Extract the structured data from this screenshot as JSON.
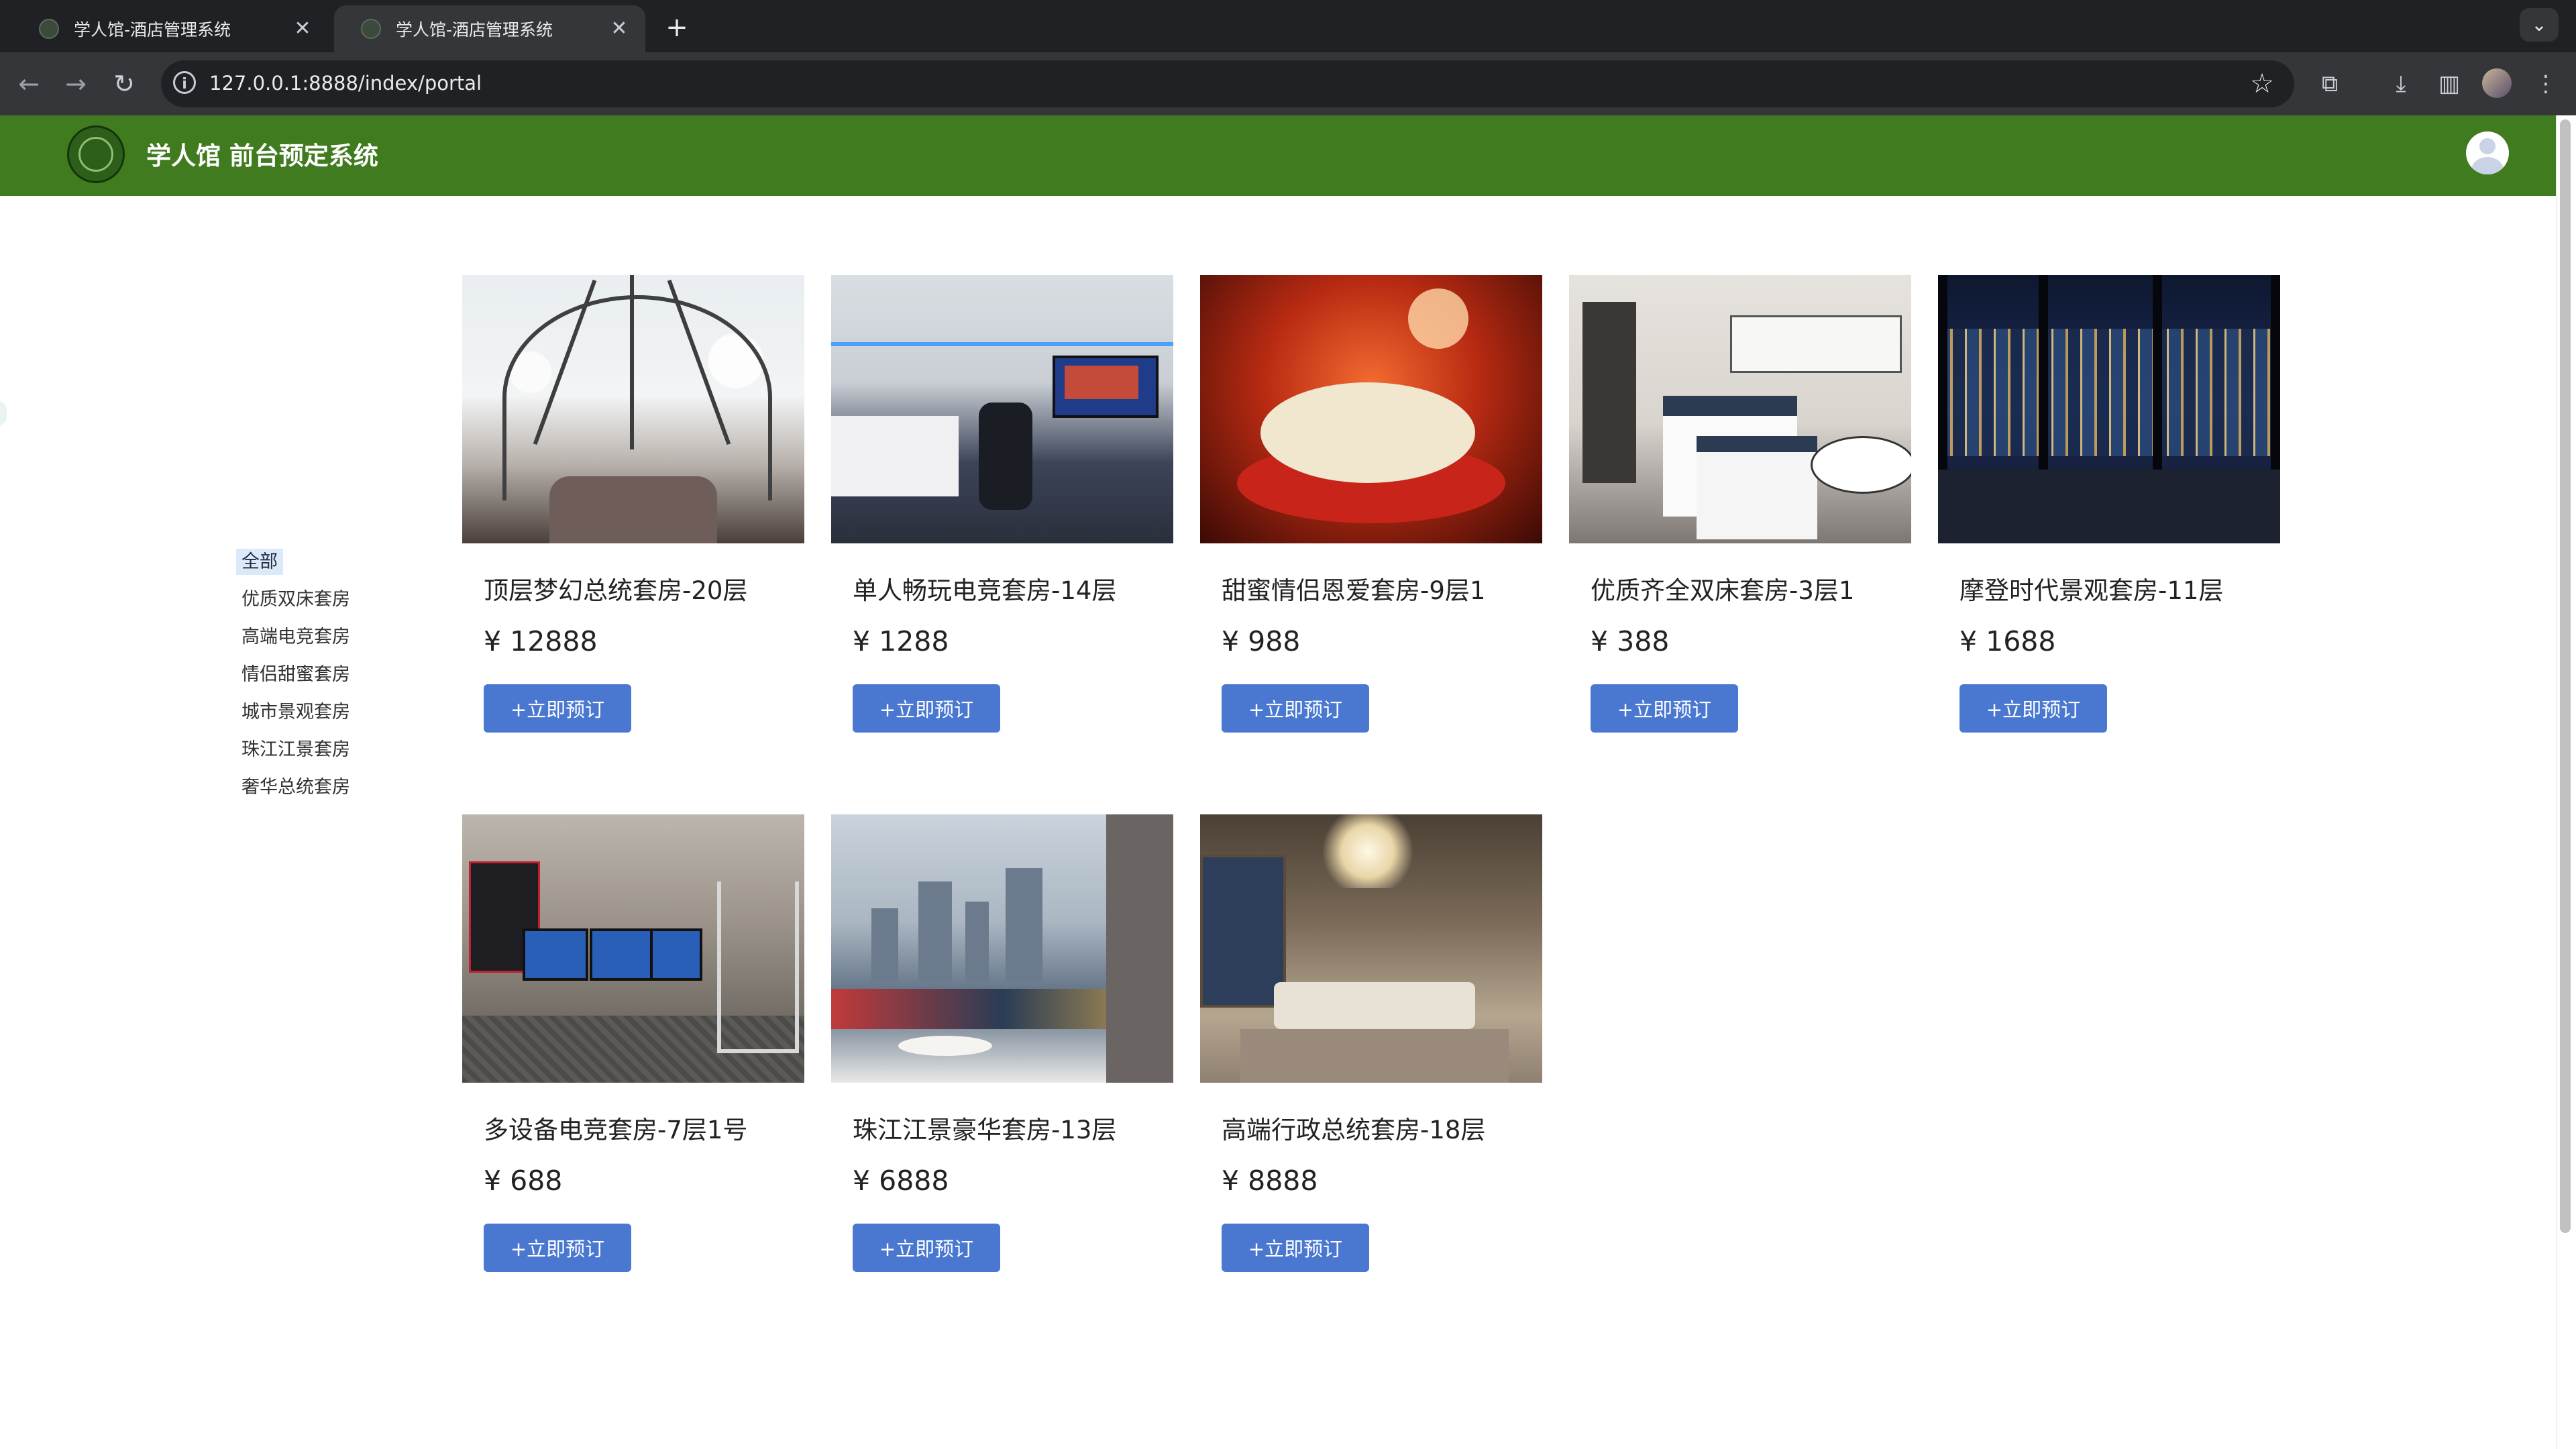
{
  "browser": {
    "tabs": [
      {
        "title": "学人馆-酒店管理系统",
        "active": false
      },
      {
        "title": "学人馆-酒店管理系统",
        "active": true
      }
    ],
    "address": "127.0.0.1:8888/index/portal"
  },
  "header": {
    "title": "学人馆 前台预定系统",
    "color": "#417b1f"
  },
  "categories": {
    "items": [
      "全部",
      "优质双床套房",
      "高端电竞套房",
      "情侣甜蜜套房",
      "城市景观套房",
      "珠江江景套房",
      "奢华总统套房"
    ],
    "selected": "全部"
  },
  "book_label": "+立即预订",
  "book_color": "#4a78d1",
  "rooms": [
    {
      "name": "顶层梦幻总统套房-20层",
      "price": "¥ 12888"
    },
    {
      "name": "单人畅玩电竞套房-14层",
      "price": "¥ 1288"
    },
    {
      "name": "甜蜜情侣恩爱套房-9层1",
      "price": "¥ 988"
    },
    {
      "name": "优质齐全双床套房-3层1",
      "price": "¥ 388"
    },
    {
      "name": "摩登时代景观套房-11层",
      "price": "¥ 1688"
    },
    {
      "name": "多设备电竞套房-7层1号",
      "price": "¥ 688"
    },
    {
      "name": "珠江江景豪华套房-13层",
      "price": "¥ 6888"
    },
    {
      "name": "高端行政总统套房-18层",
      "price": "¥ 8888"
    }
  ]
}
